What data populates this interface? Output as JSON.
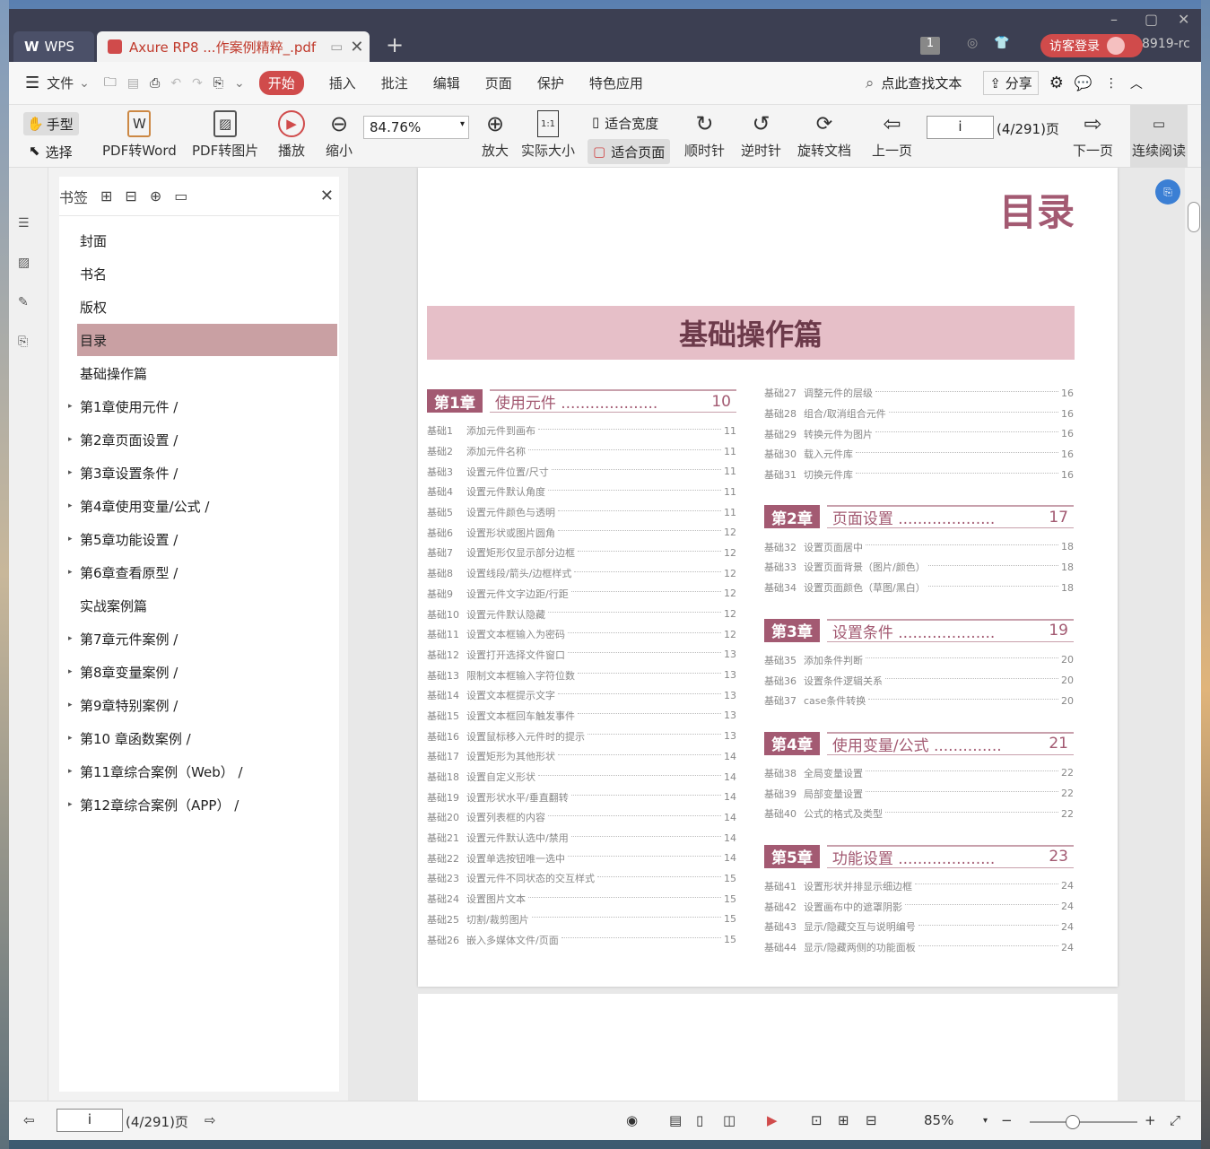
{
  "titlebar": {
    "wps_tab": "WPS",
    "doc_tab": "Axure RP8 ...作案例精粹_.pdf",
    "badge": "1",
    "login": "访客登录",
    "user_code": "8919-rc"
  },
  "menu": {
    "file": "文件",
    "items": [
      "开始",
      "插入",
      "批注",
      "编辑",
      "页面",
      "保护",
      "特色应用"
    ],
    "search": "点此查找文本",
    "share": "分享"
  },
  "toolbar": {
    "hand": "手型",
    "select": "选择",
    "pdf2word": "PDF转Word",
    "pdf2img": "PDF转图片",
    "play": "播放",
    "zoom_out": "缩小",
    "zoom_value": "84.76%",
    "zoom_in": "放大",
    "actual": "实际大小",
    "fit_width": "适合宽度",
    "fit_page": "适合页面",
    "cw": "顺时针",
    "ccw": "逆时针",
    "rotate": "旋转文档",
    "prev": "上一页",
    "page_value": "i",
    "page_total": "(4/291)页",
    "next": "下一页",
    "continuous": "连续阅读"
  },
  "bookmarks": {
    "title": "书签",
    "items": [
      {
        "label": "封面",
        "arrow": false
      },
      {
        "label": "书名",
        "arrow": false
      },
      {
        "label": "版权",
        "arrow": false
      },
      {
        "label": "目录",
        "arrow": false,
        "selected": true
      },
      {
        "label": "基础操作篇",
        "arrow": false
      },
      {
        "label": "第1章使用元件 /",
        "arrow": true
      },
      {
        "label": "第2章页面设置 /",
        "arrow": true
      },
      {
        "label": "第3章设置条件 /",
        "arrow": true
      },
      {
        "label": "第4章使用变量/公式 /",
        "arrow": true
      },
      {
        "label": "第5章功能设置 /",
        "arrow": true
      },
      {
        "label": "第6章查看原型 /",
        "arrow": true
      },
      {
        "label": "实战案例篇",
        "arrow": false
      },
      {
        "label": "第7章元件案例 /",
        "arrow": true
      },
      {
        "label": "第8章变量案例 /",
        "arrow": true
      },
      {
        "label": "第9章特别案例 /",
        "arrow": true
      },
      {
        "label": "第10 章函数案例 /",
        "arrow": true
      },
      {
        "label": "第11章综合案例（Web） /",
        "arrow": true
      },
      {
        "label": "第12章综合案例（APP） /",
        "arrow": true
      }
    ]
  },
  "page": {
    "toc_title": "目录",
    "banner": "基础操作篇",
    "left": [
      {
        "tag": "第1章",
        "name": "使用元件 ....................",
        "page": "10",
        "entries": [
          [
            "基础1",
            "添加元件到画布",
            "11"
          ],
          [
            "基础2",
            "添加元件名称",
            "11"
          ],
          [
            "基础3",
            "设置元件位置/尺寸",
            "11"
          ],
          [
            "基础4",
            "设置元件默认角度",
            "11"
          ],
          [
            "基础5",
            "设置元件颜色与透明",
            "11"
          ],
          [
            "基础6",
            "设置形状或图片圆角",
            "12"
          ],
          [
            "基础7",
            "设置矩形仅显示部分边框",
            "12"
          ],
          [
            "基础8",
            "设置线段/箭头/边框样式",
            "12"
          ],
          [
            "基础9",
            "设置元件文字边距/行距",
            "12"
          ],
          [
            "基础10",
            "设置元件默认隐藏",
            "12"
          ],
          [
            "基础11",
            "设置文本框输入为密码",
            "12"
          ],
          [
            "基础12",
            "设置打开选择文件窗口",
            "13"
          ],
          [
            "基础13",
            "限制文本框输入字符位数",
            "13"
          ],
          [
            "基础14",
            "设置文本框提示文字",
            "13"
          ],
          [
            "基础15",
            "设置文本框回车触发事件",
            "13"
          ],
          [
            "基础16",
            "设置鼠标移入元件时的提示",
            "13"
          ],
          [
            "基础17",
            "设置矩形为其他形状",
            "14"
          ],
          [
            "基础18",
            "设置自定义形状",
            "14"
          ],
          [
            "基础19",
            "设置形状水平/垂直翻转",
            "14"
          ],
          [
            "基础20",
            "设置列表框的内容",
            "14"
          ],
          [
            "基础21",
            "设置元件默认选中/禁用",
            "14"
          ],
          [
            "基础22",
            "设置单选按钮唯一选中",
            "14"
          ],
          [
            "基础23",
            "设置元件不同状态的交互样式",
            "15"
          ],
          [
            "基础24",
            "设置图片文本",
            "15"
          ],
          [
            "基础25",
            "切割/裁剪图片",
            "15"
          ],
          [
            "基础26",
            "嵌入多媒体文件/页面",
            "15"
          ]
        ]
      }
    ],
    "right_top": [
      [
        "基础27",
        "调整元件的层级",
        "16"
      ],
      [
        "基础28",
        "组合/取消组合元件",
        "16"
      ],
      [
        "基础29",
        "转换元件为图片",
        "16"
      ],
      [
        "基础30",
        "载入元件库",
        "16"
      ],
      [
        "基础31",
        "切换元件库",
        "16"
      ]
    ],
    "right": [
      {
        "tag": "第2章",
        "name": "页面设置 ....................",
        "page": "17",
        "entries": [
          [
            "基础32",
            "设置页面居中",
            "18"
          ],
          [
            "基础33",
            "设置页面背景（图片/颜色）",
            "18"
          ],
          [
            "基础34",
            "设置页面颜色（草图/黑白）",
            "18"
          ]
        ]
      },
      {
        "tag": "第3章",
        "name": "设置条件 ....................",
        "page": "19",
        "entries": [
          [
            "基础35",
            "添加条件判断",
            "20"
          ],
          [
            "基础36",
            "设置条件逻辑关系",
            "20"
          ],
          [
            "基础37",
            "case条件转换",
            "20"
          ]
        ]
      },
      {
        "tag": "第4章",
        "name": "使用变量/公式 ..............",
        "page": "21",
        "entries": [
          [
            "基础38",
            "全局变量设置",
            "22"
          ],
          [
            "基础39",
            "局部变量设置",
            "22"
          ],
          [
            "基础40",
            "公式的格式及类型",
            "22"
          ]
        ]
      },
      {
        "tag": "第5章",
        "name": "功能设置 ....................",
        "page": "23",
        "entries": [
          [
            "基础41",
            "设置形状并排显示细边框",
            "24"
          ],
          [
            "基础42",
            "设置画布中的遮罩阴影",
            "24"
          ],
          [
            "基础43",
            "显示/隐藏交互与说明编号",
            "24"
          ],
          [
            "基础44",
            "显示/隐藏两侧的功能面板",
            "24"
          ]
        ]
      }
    ]
  },
  "status": {
    "page_value": "i",
    "page_total": "(4/291)页",
    "zoom": "85%"
  },
  "colors": {
    "accent": "#d04b4b",
    "toc": "#a35a72",
    "banner": "#e6bfc8"
  }
}
